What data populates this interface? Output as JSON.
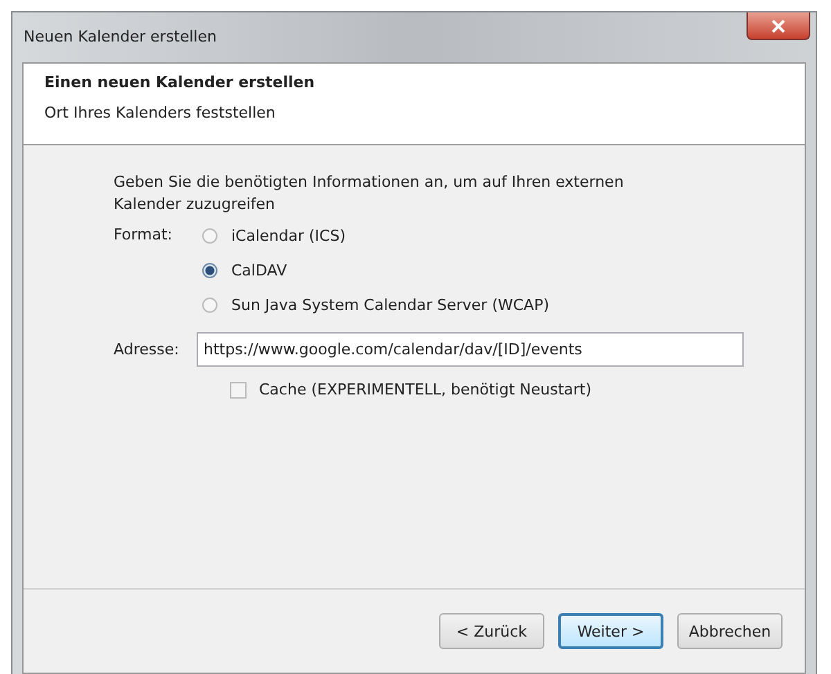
{
  "window": {
    "title": "Neuen Kalender erstellen"
  },
  "header": {
    "title": "Einen neuen Kalender erstellen",
    "subtitle": "Ort Ihres Kalenders feststellen"
  },
  "intro": "Geben Sie die benötigten Informationen an, um auf Ihren externen Kalender zuzugreifen",
  "format": {
    "label": "Format:",
    "options": [
      {
        "label": "iCalendar (ICS)",
        "selected": false
      },
      {
        "label": "CalDAV",
        "selected": true
      },
      {
        "label": "Sun Java System Calendar Server (WCAP)",
        "selected": false
      }
    ]
  },
  "address": {
    "label": "Adresse:",
    "value": "https://www.google.com/calendar/dav/[ID]/events"
  },
  "cache": {
    "label": "Cache (EXPERIMENTELL, benötigt Neustart)",
    "checked": false
  },
  "buttons": [
    {
      "label": "< Zurück",
      "focused": false
    },
    {
      "label": "Weiter >",
      "focused": true
    },
    {
      "label": "Abbrechen",
      "focused": false
    }
  ]
}
